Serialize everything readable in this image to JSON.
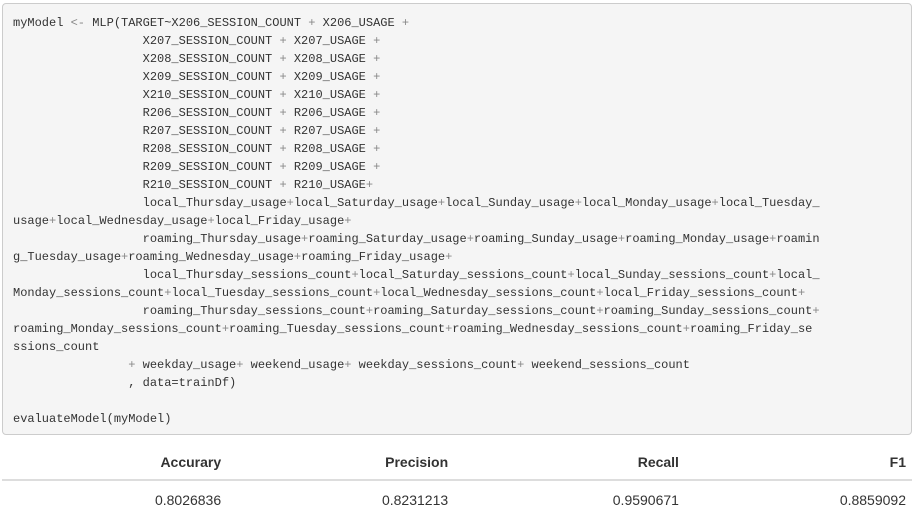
{
  "code": {
    "lines": [
      "myModel <- MLP(TARGET~X206_SESSION_COUNT + X206_USAGE +",
      "                  X207_SESSION_COUNT + X207_USAGE +",
      "                  X208_SESSION_COUNT + X208_USAGE +",
      "                  X209_SESSION_COUNT + X209_USAGE +",
      "                  X210_SESSION_COUNT + X210_USAGE +",
      "                  R206_SESSION_COUNT + R206_USAGE +",
      "                  R207_SESSION_COUNT + R207_USAGE +",
      "                  R208_SESSION_COUNT + R208_USAGE +",
      "                  R209_SESSION_COUNT + R209_USAGE +",
      "                  R210_SESSION_COUNT + R210_USAGE+",
      "                  local_Thursday_usage+local_Saturday_usage+local_Sunday_usage+local_Monday_usage+local_Tuesday_",
      "usage+local_Wednesday_usage+local_Friday_usage+",
      "                  roaming_Thursday_usage+roaming_Saturday_usage+roaming_Sunday_usage+roaming_Monday_usage+roamin",
      "g_Tuesday_usage+roaming_Wednesday_usage+roaming_Friday_usage+",
      "                  local_Thursday_sessions_count+local_Saturday_sessions_count+local_Sunday_sessions_count+local_",
      "Monday_sessions_count+local_Tuesday_sessions_count+local_Wednesday_sessions_count+local_Friday_sessions_count+",
      "                  roaming_Thursday_sessions_count+roaming_Saturday_sessions_count+roaming_Sunday_sessions_count+",
      "roaming_Monday_sessions_count+roaming_Tuesday_sessions_count+roaming_Wednesday_sessions_count+roaming_Friday_se",
      "ssions_count",
      "                + weekday_usage+ weekend_usage+ weekday_sessions_count+ weekend_sessions_count",
      "                , data=trainDf)",
      "",
      "evaluateModel(myModel)"
    ]
  },
  "results": {
    "headers": [
      "Accurary",
      "Precision",
      "Recall",
      "F1"
    ],
    "rows": [
      [
        "0.8026836",
        "0.8231213",
        "0.9590671",
        "0.8859092"
      ]
    ]
  },
  "colors": {
    "code_background": "#f5f5f5",
    "code_border": "#cccccc",
    "operator": "#888888",
    "text": "#333333",
    "table_rule": "#dddddd"
  }
}
